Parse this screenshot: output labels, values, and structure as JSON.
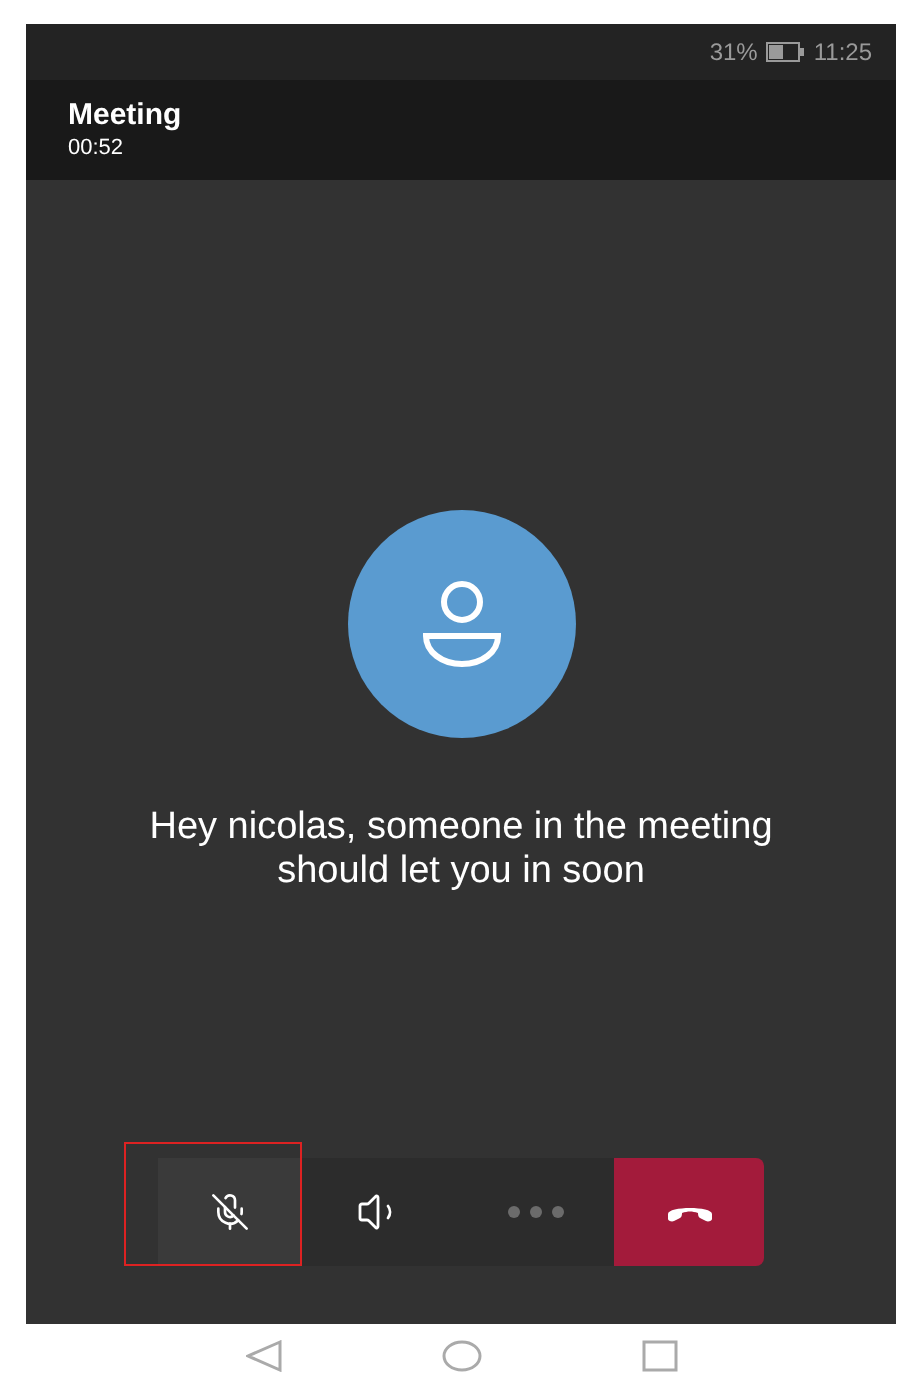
{
  "status_bar": {
    "battery": "31%",
    "time": "11:25"
  },
  "header": {
    "title": "Meeting",
    "duration": "00:52"
  },
  "message": "Hey nicolas, someone in the meeting should let you in soon",
  "controls": [
    {
      "kind": "mic",
      "muted": true,
      "highlighted": true
    },
    {
      "kind": "speaker",
      "highlighted": false
    },
    {
      "kind": "more",
      "highlighted": false
    },
    {
      "kind": "hangup",
      "highlighted": false
    }
  ]
}
